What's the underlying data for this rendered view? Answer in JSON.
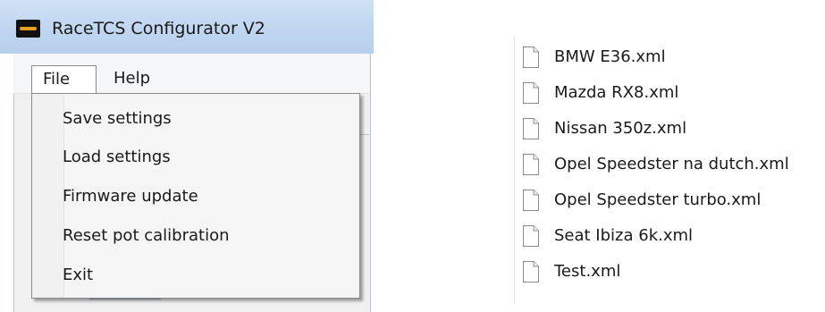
{
  "window": {
    "title": "RaceTCS Configurator V2",
    "app_icon": "racetcs-app-icon"
  },
  "menubar": {
    "file_label": "File",
    "help_label": "Help"
  },
  "file_menu": {
    "items": [
      {
        "label": "Save settings"
      },
      {
        "label": "Load settings"
      },
      {
        "label": "Firmware update"
      },
      {
        "label": "Reset pot calibration"
      },
      {
        "label": "Exit"
      }
    ]
  },
  "file_list": {
    "icon": "document-icon",
    "files": [
      {
        "name": "BMW E36.xml"
      },
      {
        "name": "Mazda RX8.xml"
      },
      {
        "name": "Nissan 350z.xml"
      },
      {
        "name": "Opel Speedster na dutch.xml"
      },
      {
        "name": "Opel Speedster turbo.xml"
      },
      {
        "name": "Seat Ibiza 6k.xml"
      },
      {
        "name": "Test.xml"
      }
    ]
  },
  "colors": {
    "titlebar": "#c0d6f0",
    "menu_background": "#f5f5f5",
    "text": "#1a1a1a"
  }
}
